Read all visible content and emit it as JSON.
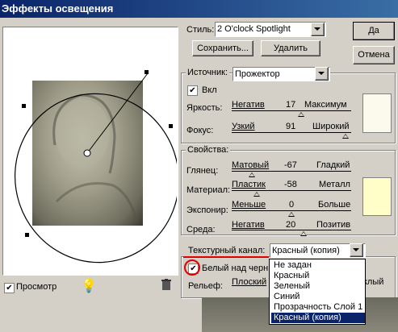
{
  "window": {
    "title": "Эффекты освещения"
  },
  "buttons": {
    "ok": "Да",
    "cancel": "Отмена",
    "save": "Сохранить...",
    "delete": "Удалить"
  },
  "style": {
    "label": "Стиль:",
    "value": "2 O'clock Spotlight"
  },
  "source": {
    "group_label": "Источник:",
    "type_value": "Прожектор",
    "on_label": "Вкл",
    "on_checked": true,
    "intensity": {
      "label": "Яркость:",
      "left": "Негатив",
      "value": "17",
      "right": "Максимум",
      "fraction": 0.58
    },
    "focus": {
      "label": "Фокус:",
      "left": "Узкий",
      "value": "91",
      "right": "Широкий",
      "fraction": 0.95
    },
    "color": "#fcfaec"
  },
  "properties": {
    "group_label": "Свойства:",
    "gloss": {
      "label": "Глянец:",
      "left": "Матовый",
      "value": "-67",
      "right": "Гладкий",
      "fraction": 0.17
    },
    "material": {
      "label": "Материал:",
      "left": "Пластик",
      "value": "-58",
      "right": "Металл",
      "fraction": 0.21
    },
    "exposure": {
      "label": "Экспонир:",
      "left": "Меньше",
      "value": "0",
      "right": "Больше",
      "fraction": 0.5
    },
    "ambience": {
      "label": "Среда:",
      "left": "Негатив",
      "value": "20",
      "right": "Позитив",
      "fraction": 0.6
    },
    "color": "#fffdc8"
  },
  "texture": {
    "label": "Текстурный канал:",
    "value": "Красный (копия)",
    "white_high_label": "Белый над черн",
    "white_high_checked": true,
    "relief_label": "Рельеф:",
    "relief_left": "Плоский",
    "relief_right": "клый",
    "options": [
      "Не задан",
      "Красный",
      "Зеленый",
      "Синий",
      "Прозрачность Слой 1",
      "Красный (копия)"
    ],
    "selected_index": 5
  },
  "preview": {
    "label": "Просмотр",
    "checked": true
  },
  "icons": {
    "bulb": "lightbulb-icon",
    "trash": "trash-icon"
  }
}
